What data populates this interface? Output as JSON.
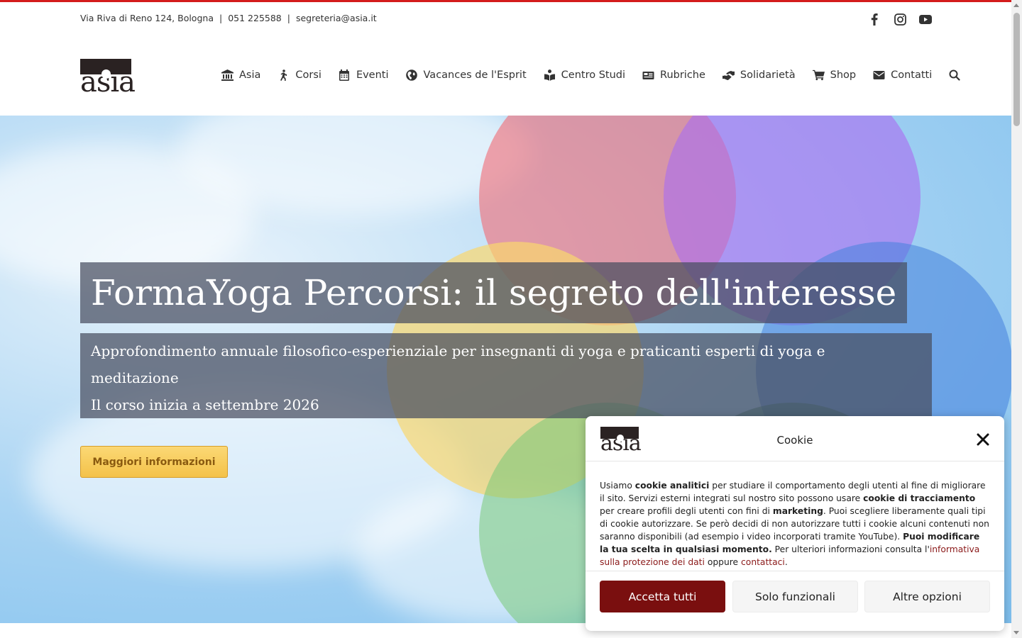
{
  "topbar": {
    "address": "Via Riva di Reno 124, Bologna",
    "separator": "|",
    "phone": "051 225588",
    "email": "segreteria@asia.it"
  },
  "social": [
    "facebook-icon",
    "instagram-icon",
    "youtube-icon"
  ],
  "logo": {
    "text": "asia"
  },
  "nav": {
    "items": [
      {
        "label": "Asia",
        "icon": "museum-icon"
      },
      {
        "label": "Corsi",
        "icon": "walking-icon"
      },
      {
        "label": "Eventi",
        "icon": "calendar-icon"
      },
      {
        "label": "Vacances de l'Esprit",
        "icon": "globe-icon"
      },
      {
        "label": "Centro Studi",
        "icon": "book-reader-icon"
      },
      {
        "label": "Rubriche",
        "icon": "newspaper-icon"
      },
      {
        "label": "Solidarietà",
        "icon": "hands-helping-icon"
      },
      {
        "label": "Shop",
        "icon": "cart-icon"
      },
      {
        "label": "Contatti",
        "icon": "envelope-icon"
      }
    ],
    "search_icon": "search-icon"
  },
  "hero": {
    "title": "FormaYoga Percorsi: il segreto dell'interesse",
    "subtitle_line1": "Approfondimento annuale filosofico-esperienziale per insegnanti di yoga e praticanti esperti di yoga e",
    "subtitle_line2": "meditazione",
    "subtitle_line3": "Il corso inizia a settembre 2026",
    "cta_label": "Maggiori informazioni"
  },
  "cookie": {
    "title": "Cookie",
    "logo_text": "asia",
    "t1": "Usiamo ",
    "b1": "cookie analitici",
    "t2": " per studiare il comportamento degli utenti al fine di migliorare il sito. Servizi esterni integrati sul nostro sito possono usare ",
    "b2": "cookie di tracciamento",
    "t3": " per creare profili degli utenti con fini di ",
    "b3": "marketing",
    "t4": ". Puoi scegliere liberamente quali tipi di cookie autorizzare. Se però decidi di non autorizzare tutti i cookie alcuni contenuti non saranno disponibili (ad esempio i video incorporati tramite YouTube). ",
    "b4": "Puoi modificare la tua scelta in qualsiasi momento.",
    "t5": " Per ulteriori informazioni consulta l'",
    "link1": "informativa sulla protezione dei dati",
    "t6": " oppure ",
    "link2": "contattaci",
    "t7": ".",
    "accept_label": "Accetta tutti",
    "functional_label": "Solo funzionali",
    "more_label": "Altre opzioni"
  }
}
